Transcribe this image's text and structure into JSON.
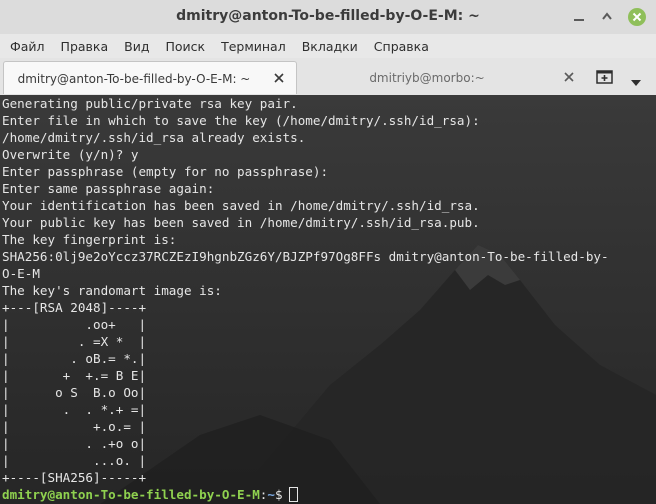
{
  "window": {
    "title": "dmitry@anton-To-be-filled-by-O-E-M: ~",
    "accent_color": "#8fbf5a",
    "controls": [
      "minimize-icon",
      "maximize-icon",
      "close-icon"
    ]
  },
  "menubar": {
    "items": [
      "Файл",
      "Правка",
      "Вид",
      "Поиск",
      "Терминал",
      "Вкладки",
      "Справка"
    ]
  },
  "tabs": [
    {
      "label": "dmitry@anton-To-be-filled-by-O-E-M: ~",
      "active": true
    },
    {
      "label": "dmitriyb@morbo:~",
      "active": false
    }
  ],
  "tabbar_buttons": [
    "new-tab-icon",
    "chevron-down-icon"
  ],
  "terminal": {
    "lines": [
      "Generating public/private rsa key pair.",
      "Enter file in which to save the key (/home/dmitry/.ssh/id_rsa):",
      "/home/dmitry/.ssh/id_rsa already exists.",
      "Overwrite (y/n)? y",
      "Enter passphrase (empty for no passphrase):",
      "Enter same passphrase again:",
      "Your identification has been saved in /home/dmitry/.ssh/id_rsa.",
      "Your public key has been saved in /home/dmitry/.ssh/id_rsa.pub.",
      "The key fingerprint is:",
      "SHA256:0lj9e2oYccz37RCZEzI9hgnbZGz6Y/BJZPf97Og8FFs dmitry@anton-To-be-filled-by-",
      "O-E-M",
      "The key's randomart image is:",
      "+---[RSA 2048]----+",
      "|          .oo+   |",
      "|         . =X *  |",
      "|        . oB.= *.|",
      "|       +  +.= B E|",
      "|      o S  B.o Oo|",
      "|       .  . *.+ =|",
      "|           +.o.= |",
      "|          . .+o o|",
      "|           ...o. |",
      "+----[SHA256]-----+"
    ],
    "prompt": {
      "user_host": "dmitry@anton-To-be-filled-by-O-E-M",
      "separator": ":",
      "path": "~",
      "symbol": "$"
    },
    "colors": {
      "user_host": "#8fd14f",
      "path": "#7aa7e0",
      "text": "#e6e6e6"
    }
  }
}
